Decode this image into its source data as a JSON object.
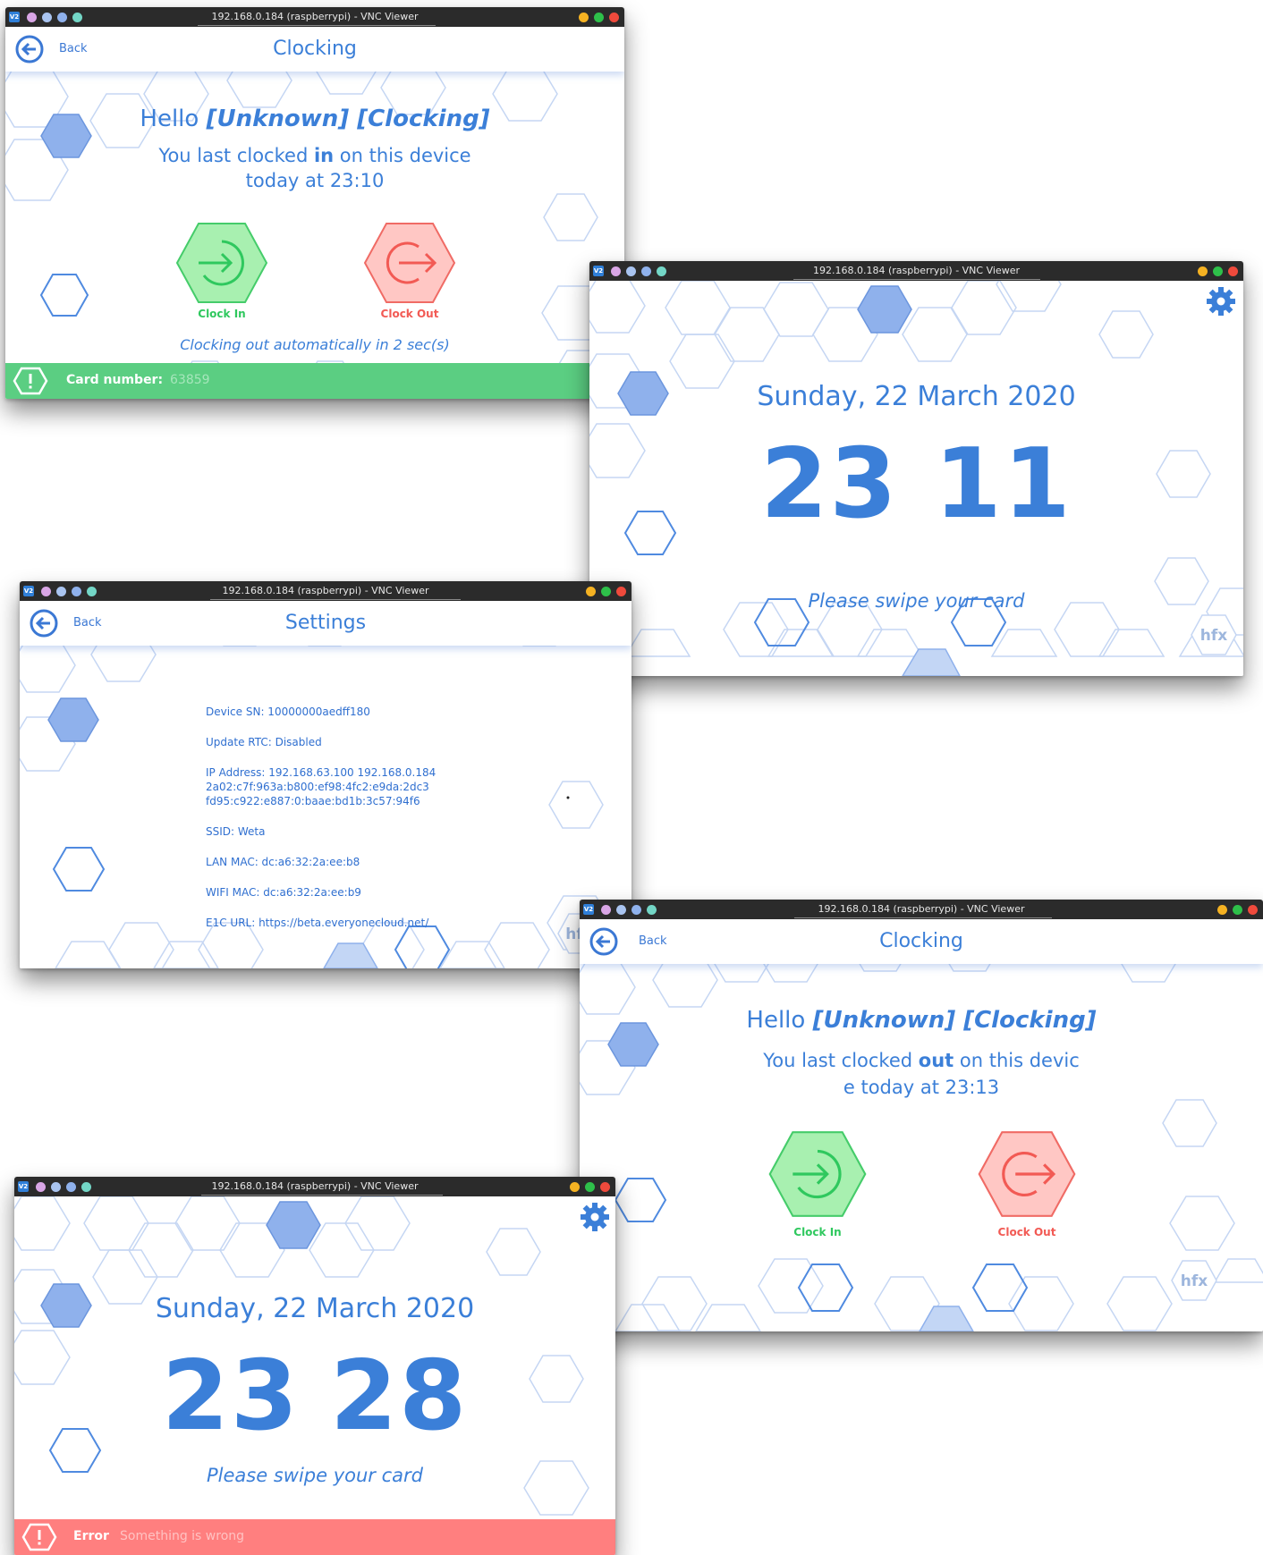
{
  "vnc": {
    "title": "192.168.0.184 (raspberrypi) - VNC Viewer",
    "logo": "V2",
    "colors": {
      "left_dots": [
        "#d9a6e6",
        "#a9c4f0",
        "#8fb1ec",
        "#73d6c6"
      ],
      "right_dots": [
        "#f5b222",
        "#2ec04a",
        "#ef4a3c"
      ]
    }
  },
  "theme": {
    "accent": "#3b7fd8",
    "hex_fill": "#8fb1ec",
    "clock_in_fill": "#a8f0b0",
    "clock_in_color": "#2fc85e",
    "clock_out_fill": "#ffc7c4",
    "clock_out_color": "#f25a54",
    "success": "#5bce82",
    "error": "#ff7f7f"
  },
  "icons": {
    "back": "back-arrow-circle-icon",
    "clock_in": "clock-in-icon",
    "clock_out": "clock-out-icon",
    "settings": "gear-icon",
    "alert": "warning-hexagon-icon",
    "brand": "hfx-logo-icon"
  },
  "clocking_in": {
    "back_label": "Back",
    "title": "Clocking",
    "hello_prefix": "Hello ",
    "hello_name": "[Unknown] [Clocking]",
    "last_prefix": "You last clocked ",
    "last_action": "in",
    "last_suffix": " on this device",
    "last_line2": "today at 23:10",
    "clock_in_label": "Clock In",
    "clock_out_label": "Clock Out",
    "auto_note": "Clocking out automatically in 2 sec(s)",
    "status_label": "Card number:",
    "status_value": "63859"
  },
  "idle_1": {
    "date": "Sunday, 22 March 2020",
    "hour": "23",
    "minute": "11",
    "prompt": "Please swipe your card",
    "brand": "hfx"
  },
  "settings": {
    "back_label": "Back",
    "title": "Settings",
    "device_sn": "Device SN: 10000000aedff180",
    "update_rtc": "Update RTC: Disabled",
    "ip_line1": "IP Address: 192.168.63.100 192.168.0.184",
    "ip_line2": "2a02:c7f:963a:b800:ef98:4fc2:e9da:2dc3",
    "ip_line3": "fd95:c922:e887:0:baae:bd1b:3c57:94f6",
    "ssid": "SSID: Weta",
    "lan_mac": "LAN MAC: dc:a6:32:2a:ee:b8",
    "wifi_mac": "WIFI MAC: dc:a6:32:2a:ee:b9",
    "e1c_url": "E1C URL: https://beta.everyonecloud.net/",
    "brand": "hf"
  },
  "clocking_out": {
    "back_label": "Back",
    "title": "Clocking",
    "hello_prefix": "Hello ",
    "hello_name": "[Unknown] [Clocking]",
    "last_prefix": "You last clocked ",
    "last_action": "out",
    "last_suffix": " on this devic",
    "last_line2": "e today at 23:13",
    "clock_in_label": "Clock In",
    "clock_out_label": "Clock Out",
    "brand": "hfx"
  },
  "idle_2": {
    "date": "Sunday, 22 March 2020",
    "hour": "23",
    "minute": "28",
    "prompt": "Please swipe your card",
    "status_label": "Error",
    "status_value": "Something is wrong"
  }
}
